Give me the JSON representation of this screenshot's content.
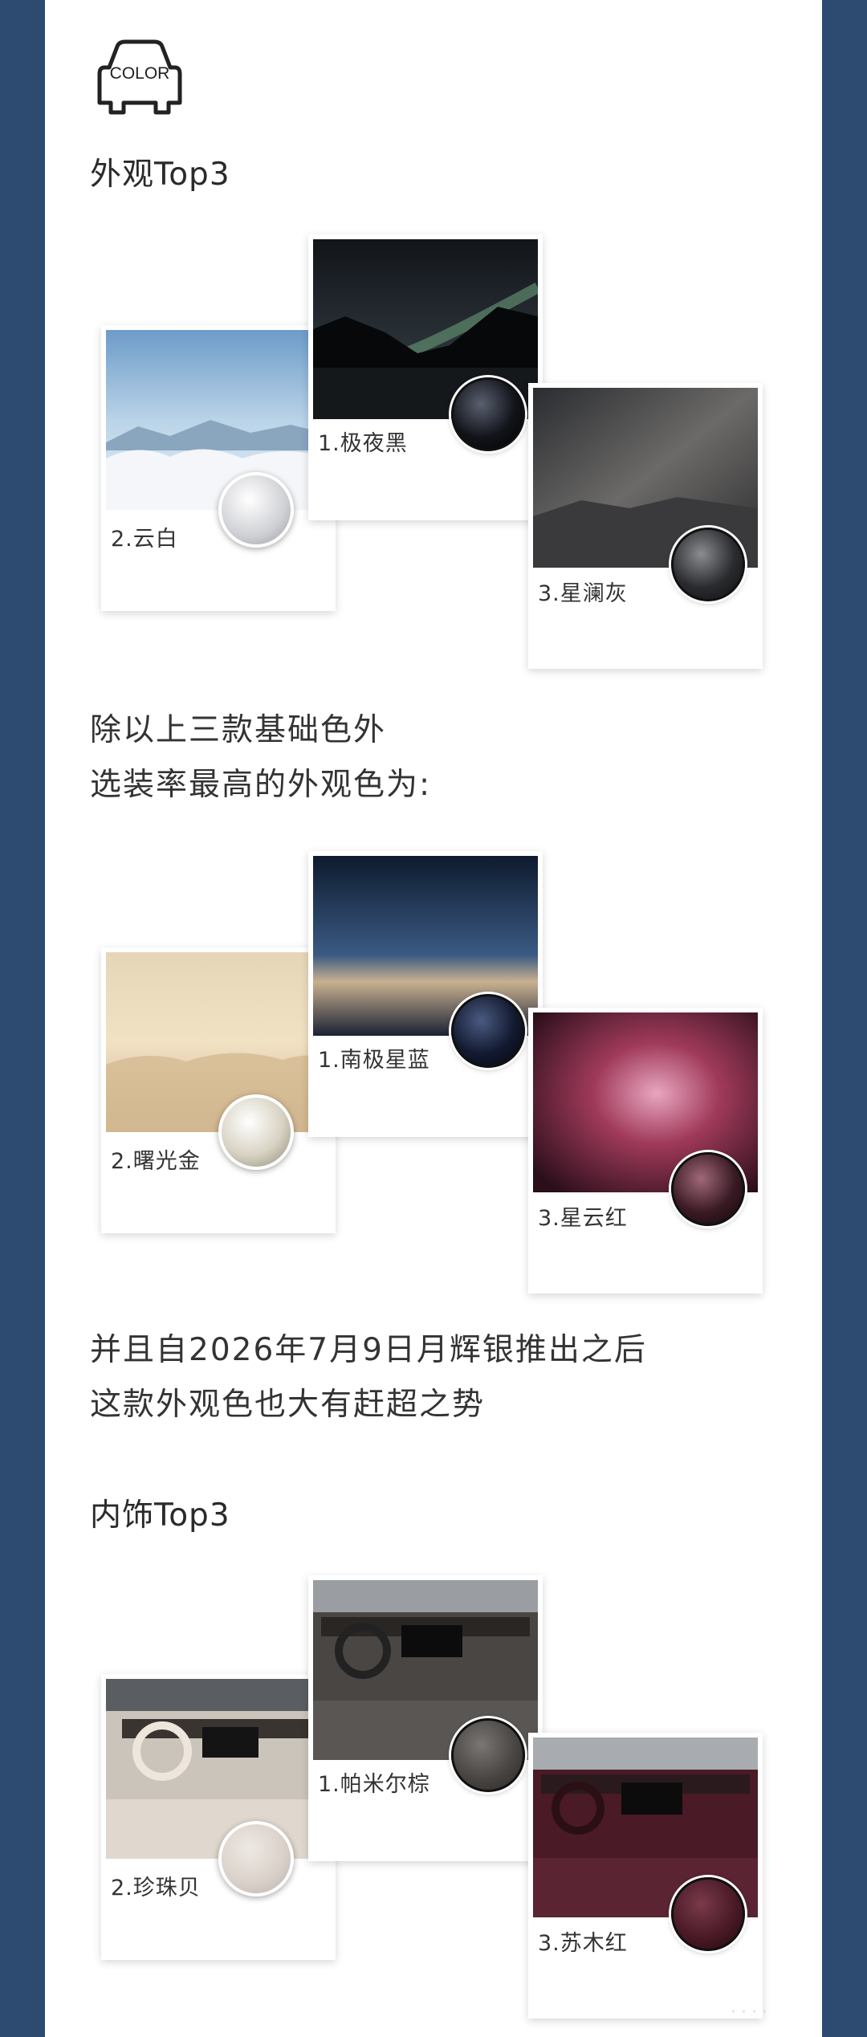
{
  "logo": {
    "text": "COLOR",
    "icon": "car-outline-icon"
  },
  "exterior": {
    "heading": "外观Top3",
    "cards": [
      {
        "label": "1.极夜黑",
        "swatch": "#0b0d14"
      },
      {
        "label": "2.云白",
        "swatch": "#e8e8ea"
      },
      {
        "label": "3.星澜灰",
        "swatch": "#1c1c1e"
      }
    ]
  },
  "paragraph1": {
    "line1": "除以上三款基础色外",
    "line2": "选装率最高的外观色为:"
  },
  "popular": {
    "cards": [
      {
        "label": "1.南极星蓝",
        "swatch": "#141c32"
      },
      {
        "label": "2.曙光金",
        "swatch": "#d9d4c6"
      },
      {
        "label": "3.星云红",
        "swatch": "#3a1a24"
      }
    ]
  },
  "paragraph2": {
    "line1": "并且自2026年7月9日月辉银推出之后",
    "line2": "这款外观色也大有赶超之势"
  },
  "interior": {
    "heading": "内饰Top3",
    "cards": [
      {
        "label": "1.帕米尔棕",
        "swatch": "#4a4644"
      },
      {
        "label": "2.珍珠贝",
        "swatch": "#d8d2cc"
      },
      {
        "label": "3.苏木红",
        "swatch": "#4a1a26"
      }
    ]
  },
  "watermark": "····"
}
